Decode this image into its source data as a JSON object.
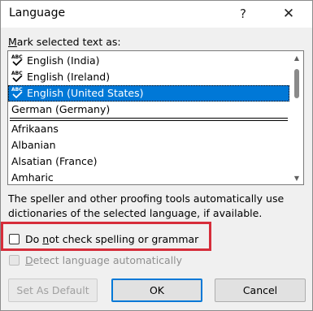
{
  "window": {
    "title": "Language",
    "help_glyph": "?",
    "close_glyph": "✕"
  },
  "mark_label_prefix": "M",
  "mark_label_rest": "ark selected text as:",
  "languages_top": [
    "English (India)",
    "English (Ireland)",
    "English (United States)",
    "German (Germany)"
  ],
  "languages_bottom": [
    "Afrikaans",
    "Albanian",
    "Alsatian (France)",
    "Amharic"
  ],
  "spell_icon_text": "ABC",
  "info_text": "The speller and other proofing tools automatically use dictionaries of the selected language, if available.",
  "checkbox_no_check": {
    "label_prefix": "Do ",
    "label_underlined": "n",
    "label_rest": "ot check spelling or grammar",
    "checked": false
  },
  "checkbox_detect": {
    "label_prefix": "",
    "label_underlined": "D",
    "label_rest": "etect language automatically",
    "checked": false,
    "disabled": true
  },
  "buttons": {
    "set_default": "Set As Default",
    "ok": "OK",
    "cancel": "Cancel"
  },
  "colors": {
    "selection": "#0078d7",
    "highlight_border": "#d62d3a",
    "dialog_bg": "#f0f0f0"
  }
}
